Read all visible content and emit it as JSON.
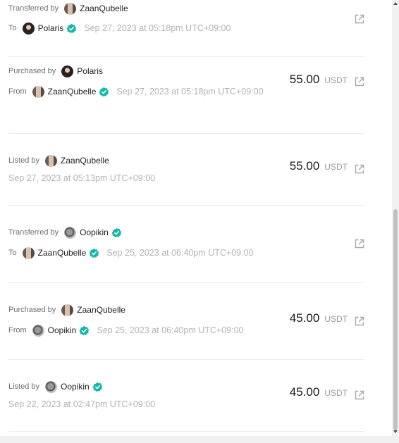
{
  "colors": {
    "verified": "#14b8a6",
    "date": "#b3b3b3"
  },
  "activities": [
    {
      "line1_label": "Transferred by",
      "line1_name": "ZaanQubelle",
      "line1_avatar": "zaan",
      "line1_verified": false,
      "line2_label": "To",
      "line2_name": "Polaris",
      "line2_avatar": "polaris",
      "line2_verified": true,
      "date": "Sep 27, 2023 at 05:18pm UTC+09:00",
      "price": "",
      "currency": ""
    },
    {
      "line1_label": "Purchased by",
      "line1_name": "Polaris",
      "line1_avatar": "polaris",
      "line1_verified": false,
      "line2_label": "From",
      "line2_name": "ZaanQubelle",
      "line2_avatar": "zaan",
      "line2_verified": true,
      "date": "Sep 27, 2023 at 05:18pm UTC+09:00",
      "price": "55.00",
      "currency": "USDT"
    },
    {
      "line1_label": "Listed by",
      "line1_name": "ZaanQubelle",
      "line1_avatar": "zaan",
      "line1_verified": false,
      "date": "Sep 27, 2023 at 05:13pm UTC+09:00",
      "price": "55.00",
      "currency": "USDT"
    },
    {
      "line1_label": "Transferred by",
      "line1_name": "Oopikin",
      "line1_avatar": "oop",
      "line1_verified": true,
      "line2_label": "To",
      "line2_name": "ZaanQubelle",
      "line2_avatar": "zaan",
      "line2_verified": true,
      "date": "Sep 25, 2023 at 06:40pm UTC+09:00",
      "price": "",
      "currency": ""
    },
    {
      "line1_label": "Purchased by",
      "line1_name": "ZaanQubelle",
      "line1_avatar": "zaan",
      "line1_verified": false,
      "line2_label": "From",
      "line2_name": "Oopikin",
      "line2_avatar": "oop",
      "line2_verified": true,
      "date": "Sep 25, 2023 at 06:40pm UTC+09:00",
      "price": "45.00",
      "currency": "USDT"
    },
    {
      "line1_label": "Listed by",
      "line1_name": "Oopikin",
      "line1_avatar": "oop",
      "line1_verified": true,
      "date": "Sep 22, 2023 at 02:47pm UTC+09:00",
      "price": "45.00",
      "currency": "USDT"
    }
  ]
}
